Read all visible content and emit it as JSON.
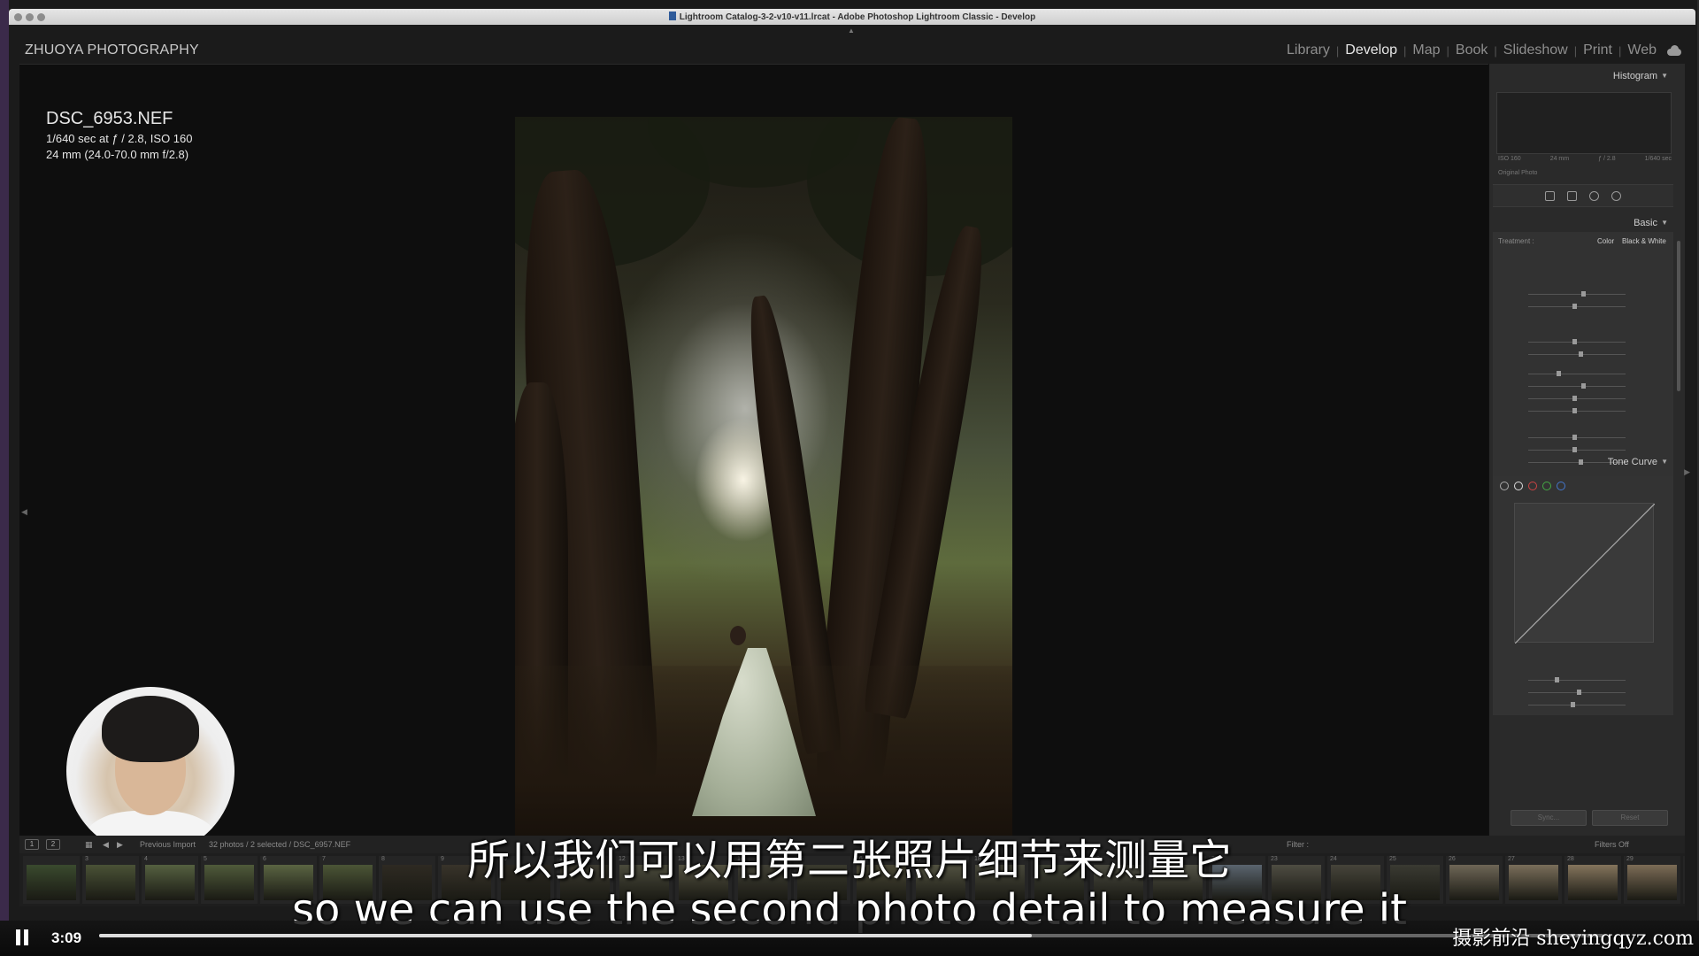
{
  "window": {
    "title": "Lightroom Catalog-3-2-v10-v11.lrcat - Adobe Photoshop Lightroom Classic - Develop"
  },
  "app": {
    "identity_plate": "ZHUOYA PHOTOGRAPHY",
    "modules": [
      "Library",
      "Develop",
      "Map",
      "Book",
      "Slideshow",
      "Print",
      "Web"
    ],
    "active_module": "Develop"
  },
  "photo_info": {
    "filename": "DSC_6953.NEF",
    "exposure": "1/640 sec at ƒ / 2.8, ISO 160",
    "lens": "24 mm (24.0-70.0 mm f/2.8)"
  },
  "right_panel": {
    "histogram_label": "Histogram",
    "histogram_meta": [
      "ISO 160",
      "24 mm",
      "ƒ / 2.8",
      "1/640 sec"
    ],
    "original_photo": "Original Photo",
    "basic_label": "Basic",
    "treatment_label": "Treatment :",
    "treatment_options": [
      "Color",
      "Black & White"
    ],
    "tone_curve_label": "Tone Curve",
    "sync_buttons": [
      "Sync...",
      "Reset"
    ]
  },
  "filmstrip_toolbar": {
    "source": "Previous Import",
    "selection": "32 photos / 2 selected / DSC_6957.NEF",
    "filter_label": "Filter :",
    "filters_off": "Filters Off"
  },
  "filmstrip": {
    "thumbnails": [
      {
        "num": "",
        "color": "#3a4a2e"
      },
      {
        "num": "3",
        "color": "#4a5236"
      },
      {
        "num": "4",
        "color": "#556040"
      },
      {
        "num": "5",
        "color": "#4f5a3a"
      },
      {
        "num": "6",
        "color": "#5a6442"
      },
      {
        "num": "7",
        "color": "#4b5536"
      },
      {
        "num": "8",
        "color": "#2e2a22"
      },
      {
        "num": "9",
        "color": "#38332a"
      },
      {
        "num": "10",
        "color": "#2a2720"
      },
      {
        "num": "11",
        "color": "#3c3a30"
      },
      {
        "num": "12",
        "color": "#4a4a3c"
      },
      {
        "num": "13",
        "color": "#52503f"
      },
      {
        "num": "14",
        "color": "#403f34"
      },
      {
        "num": "15",
        "color": "#3a3a2e"
      },
      {
        "num": "16",
        "color": "#4a4836"
      },
      {
        "num": "17",
        "color": "#515140"
      },
      {
        "num": "18",
        "color": "#47473a"
      },
      {
        "num": "19",
        "color": "#3e4034"
      },
      {
        "num": "20",
        "color": "#4a4a40"
      },
      {
        "num": "21",
        "color": "#525246"
      },
      {
        "num": "22",
        "color": "#5a646e"
      },
      {
        "num": "23",
        "color": "#4e4c42"
      },
      {
        "num": "24",
        "color": "#46443a"
      },
      {
        "num": "25",
        "color": "#3a3a32"
      },
      {
        "num": "26",
        "color": "#6e6656"
      },
      {
        "num": "27",
        "color": "#7a6e5a"
      },
      {
        "num": "28",
        "color": "#84745c"
      },
      {
        "num": "29",
        "color": "#7c6c56"
      },
      {
        "num": "30",
        "color": "#6a5e4c"
      }
    ]
  },
  "subtitles": {
    "chinese": "所以我们可以用第二张照片细节来测量它",
    "english": "so we can use the second photo detail to measure it"
  },
  "player": {
    "time": "3:09",
    "progress": 0.62,
    "watermark": "摄影前沿 sheyingqyz.com"
  }
}
